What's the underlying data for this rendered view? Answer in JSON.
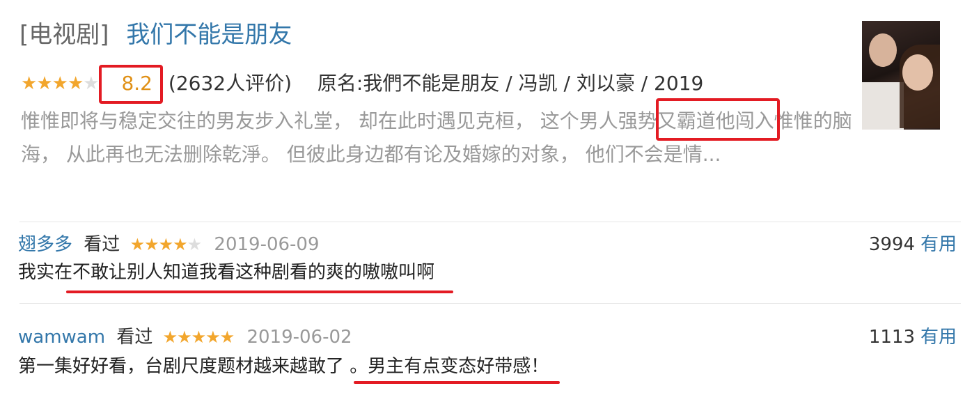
{
  "item": {
    "type_label": "[电视剧]",
    "title": "我们不能是朋友",
    "rating_stars": 4,
    "rating": "8.2",
    "rating_count": "(2632人评价)",
    "original_info": "原名:我們不能是朋友 / 冯凯 / 刘以豪 / 2019",
    "description": "惟惟即将与稳定交往的男友步入礼堂， 却在此时遇见克桓， 这个男人强势又霸道他闯入惟惟的脑海， 从此再也无法删除乾淨。 但彼此身边都有论及婚嫁的对象， 他们不会是情..."
  },
  "poster": {
    "icon": "drama-poster-image"
  },
  "comments": [
    {
      "user": "翅多多",
      "action": "看过",
      "stars": 4,
      "date": "2019-06-09",
      "text": "我实在不敢让别人知道我看这种剧看的爽的嗷嗷叫啊",
      "votes": "3994",
      "useful_label": "有用"
    },
    {
      "user": "wamwam",
      "action": "看过",
      "stars": 5,
      "date": "2019-06-02",
      "text": "第一集好好看，台剧尺度题材越来越敢了 。男主有点变态好带感！",
      "votes": "1113",
      "useful_label": "有用"
    }
  ],
  "colors": {
    "link": "#3377aa",
    "star": "#f2a62d",
    "rating": "#e09015",
    "highlight": "#e31b23"
  }
}
